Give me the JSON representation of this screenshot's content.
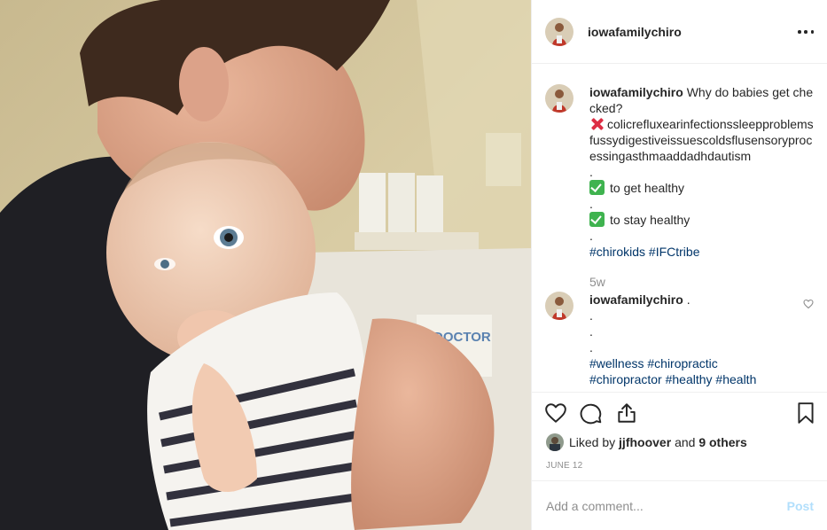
{
  "post": {
    "username": "iowafamilychiro",
    "more_icon": "more-options-icon",
    "caption": {
      "username": "iowafamilychiro",
      "line1": "Why do babies get checked?",
      "x_emoji": "cross-mark-icon",
      "conditions": "colicrefluxearinfectionssleepproblemsfussydigestiveissuescoldsflusensoryprocessingasthmaaddadhdautism",
      "dot": ".",
      "check_emoji": "check-mark-icon",
      "get_healthy": "to get healthy",
      "stay_healthy": "to stay healthy",
      "hashtags": [
        "#chirokids",
        "#IFCtribe"
      ]
    },
    "caption_time": "5w",
    "comment": {
      "username": "iowafamilychiro",
      "text": ".",
      "dots": [
        ".",
        ".",
        "."
      ],
      "hashtags_line1": [
        "#wellness",
        "#chiropractic"
      ],
      "hashtags_line2": [
        "#chiropractor",
        "#healthy",
        "#health"
      ]
    },
    "actions": {
      "like": "heart-icon",
      "comment": "comment-icon",
      "share": "share-icon",
      "save": "bookmark-icon"
    },
    "likes": {
      "prefix": "Liked by",
      "user": "jjfhoover",
      "and": "and",
      "others": "9 others"
    },
    "date": "JUNE 12",
    "add_comment": {
      "placeholder": "Add a comment...",
      "post_label": "Post"
    }
  }
}
